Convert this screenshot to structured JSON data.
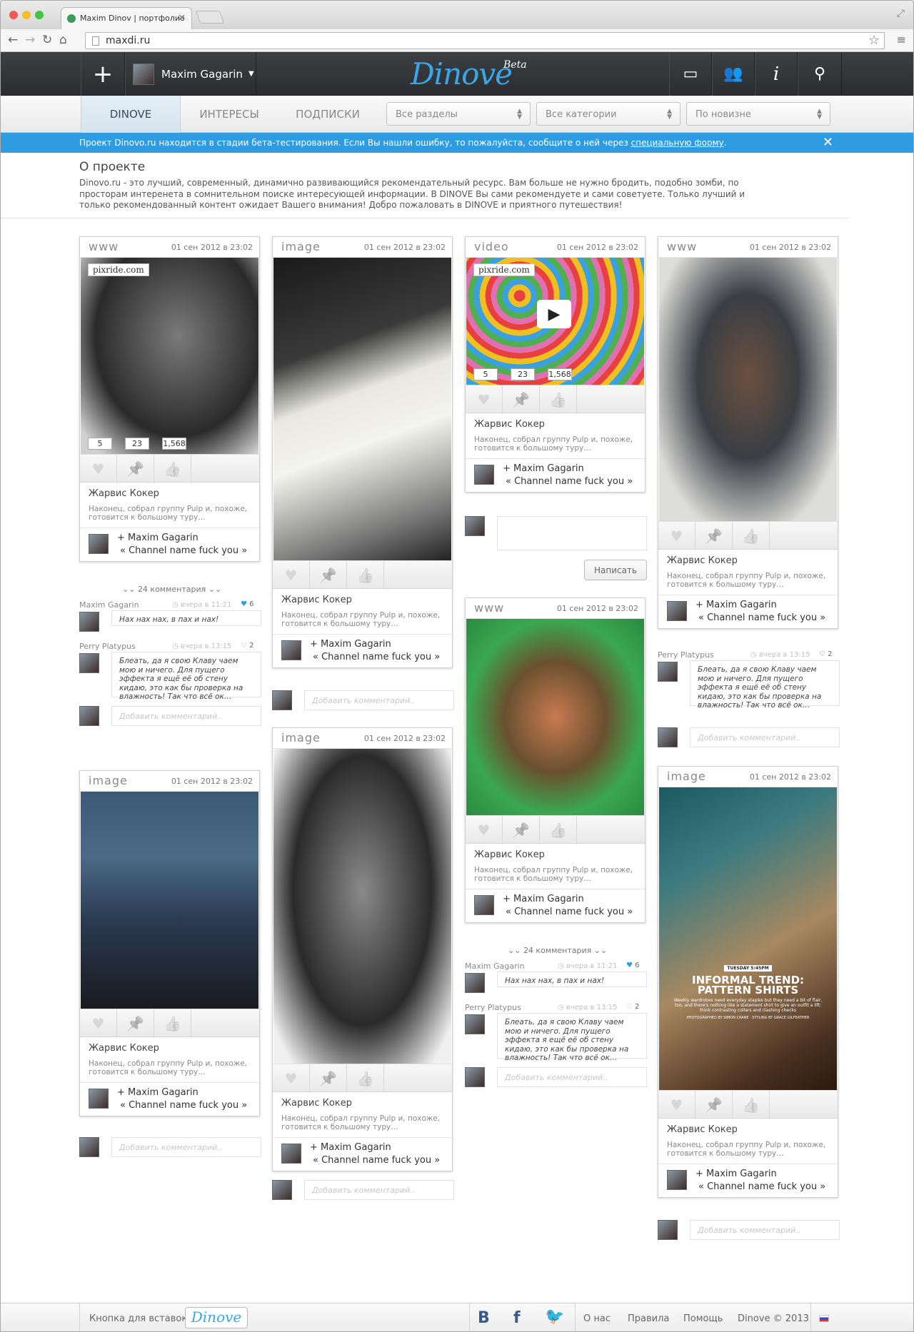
{
  "browser": {
    "tab_title": "Maxim Dinov | портфолио",
    "url": "maxdi.ru"
  },
  "header": {
    "logo": "Dinove",
    "beta": "Beta",
    "user_name": "Maxim Gagarin"
  },
  "subnav": {
    "tabs": [
      "DINOVE",
      "ИНТЕРЕСЫ",
      "ПОДПИСКИ"
    ],
    "selects": [
      "Все разделы",
      "Все категории",
      "По новизне"
    ]
  },
  "beta_bar": {
    "text": "Проект Dinovo.ru находится в стадии бета-тестирования. Если Вы нашли ошибку, то пожалуйста, сообщите о ней через ",
    "link": "специальную форму",
    "end": "."
  },
  "about": {
    "title": "О проекте",
    "text": "Dinovo.ru - это лучший, современный, динамично развивающийся рекомендательный ресурс. Вам больше не нужно бродить, подобно зомби, по просторам интеренета в сомнительном поиске интересующей информации. В DINOVE Вы сами рекомендуете и сами советуете. Только лучший и только рекомендованный контент ожидает Вашего внимания! Добро пожаловать в DINOVE и приятного путешествия!"
  },
  "card_common": {
    "date": "01 сен 2012 в 23:02",
    "title": "Жарвис Кокер",
    "desc": "Наконец, собрал группу Pulp и, похоже, готовится к большому туру…",
    "author": "+ Maxim Gagarin",
    "channel": "« Channel name fuck you »",
    "source": "pixride.com",
    "counts": [
      "5",
      "23",
      "1,568"
    ]
  },
  "types": {
    "www": "www",
    "image": "image",
    "video": "video"
  },
  "comments": {
    "count_label": "24 комментария",
    "add_placeholder": "Добавить комментарий..",
    "write_button": "Написать",
    "c1": {
      "name": "Maxim Gagarin",
      "time": "вчера в 11:21",
      "likes": "6",
      "text": "Нах нах нах, в пах и нах!"
    },
    "c2": {
      "name": "Perry Platypus",
      "time": "вчера в 13:15",
      "likes": "2",
      "text": "Блеать, да я свою Клаву чаем мою и ничего. Для пущего эффекта я ещё её об стену кидаю, это как бы проверка на влажность! Так что всё ок…"
    }
  },
  "magazine": {
    "badge": "TUESDAY 5:45PM",
    "headline": "INFORMAL TREND: PATTERN SHIRTS",
    "subtext": "Weekly wardrobes need everyday staples but they need a bit of flair, too, and there's nothing like a statement shirt to give an outfit a lift: think contrasting collars and clashing checks",
    "credit": "PHOTOGRAPHED BY SIMON CRANE · STYLING BY GRACE GILFEATHER"
  },
  "footer": {
    "embed": "Кнопка для вставок",
    "logo": "Dinove",
    "links": [
      "О нас",
      "Правила",
      "Помощь",
      "Dinove © 2013"
    ]
  },
  "colors": {
    "accent": "#2f9be0",
    "header": "#2f3235"
  }
}
